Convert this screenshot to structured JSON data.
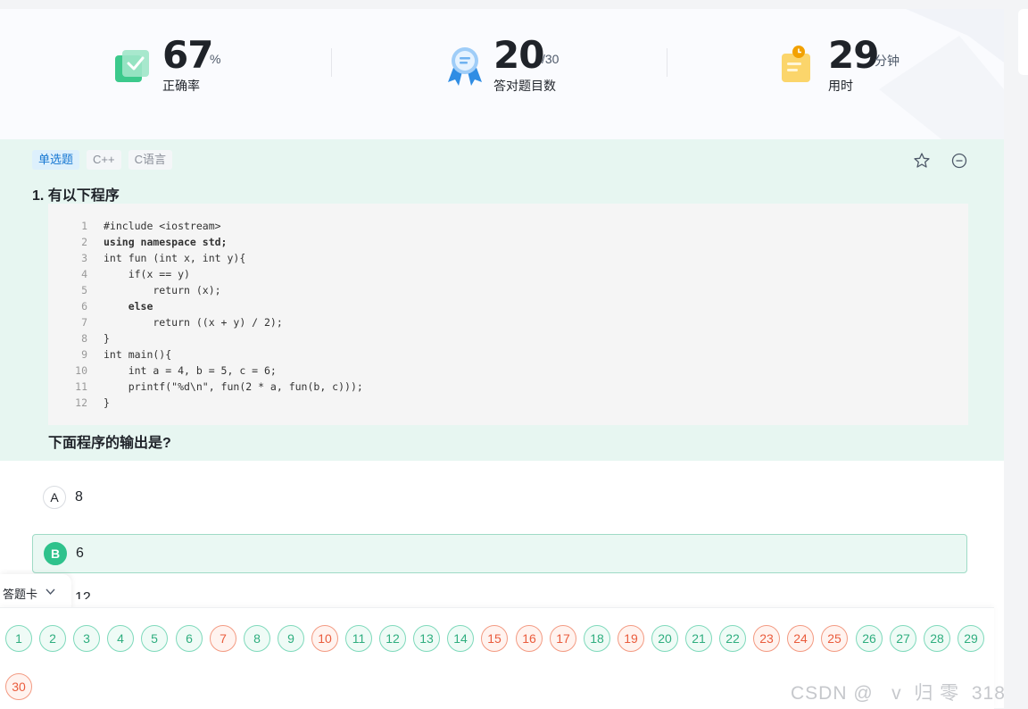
{
  "stats": [
    {
      "value": "67",
      "unit": "%",
      "label": "正确率",
      "icon": "accuracy-check-icon"
    },
    {
      "value": "20",
      "unit": "/30",
      "label": "答对题目数",
      "icon": "medal-icon"
    },
    {
      "value": "29",
      "unit": "分钟",
      "label": "用时",
      "icon": "timer-clipboard-icon"
    }
  ],
  "question": {
    "tags": [
      "单选题",
      "C++",
      "C语言"
    ],
    "title": "1. 有以下程序",
    "code_lines": [
      "#include <iostream>",
      "using namespace std;",
      "int fun (int x, int y){",
      "    if(x == y)",
      "        return (x);",
      "    else",
      "        return ((x + y) / 2);",
      "}",
      "int main(){",
      "    int a = 4, b = 5, c = 6;",
      "    printf(\"%d\\n\", fun(2 * a, fun(b, c)));",
      "}"
    ],
    "line_numbers": [
      "1",
      "2",
      "3",
      "4",
      "5",
      "6",
      "7",
      "8",
      "9",
      "10",
      "11",
      "12"
    ],
    "prompt": "下面程序的输出是?"
  },
  "options": [
    {
      "letter": "A",
      "text": "8",
      "selected": false
    },
    {
      "letter": "B",
      "text": "6",
      "selected": true
    }
  ],
  "partial_option_text": "12",
  "answer_card": {
    "toggle_label": "答题卡",
    "items": [
      {
        "n": "1",
        "status": "correct"
      },
      {
        "n": "2",
        "status": "correct"
      },
      {
        "n": "3",
        "status": "correct"
      },
      {
        "n": "4",
        "status": "correct"
      },
      {
        "n": "5",
        "status": "correct"
      },
      {
        "n": "6",
        "status": "correct"
      },
      {
        "n": "7",
        "status": "wrong"
      },
      {
        "n": "8",
        "status": "correct"
      },
      {
        "n": "9",
        "status": "correct"
      },
      {
        "n": "10",
        "status": "wrong"
      },
      {
        "n": "11",
        "status": "correct"
      },
      {
        "n": "12",
        "status": "correct"
      },
      {
        "n": "13",
        "status": "correct"
      },
      {
        "n": "14",
        "status": "correct"
      },
      {
        "n": "15",
        "status": "wrong"
      },
      {
        "n": "16",
        "status": "wrong"
      },
      {
        "n": "17",
        "status": "wrong"
      },
      {
        "n": "18",
        "status": "correct"
      },
      {
        "n": "19",
        "status": "wrong"
      },
      {
        "n": "20",
        "status": "correct"
      },
      {
        "n": "21",
        "status": "correct"
      },
      {
        "n": "22",
        "status": "correct"
      },
      {
        "n": "23",
        "status": "wrong"
      },
      {
        "n": "24",
        "status": "wrong"
      },
      {
        "n": "25",
        "status": "wrong"
      },
      {
        "n": "26",
        "status": "correct"
      },
      {
        "n": "27",
        "status": "correct"
      },
      {
        "n": "28",
        "status": "correct"
      },
      {
        "n": "29",
        "status": "correct"
      },
      {
        "n": "30",
        "status": "wrong"
      }
    ]
  },
  "colors": {
    "correct": "#2fae7f",
    "wrong": "#ea5c3d",
    "question_bg": "#e7f6f1",
    "accent": "#2fc28c"
  },
  "watermark": "CSDN @   v  归 零  318"
}
